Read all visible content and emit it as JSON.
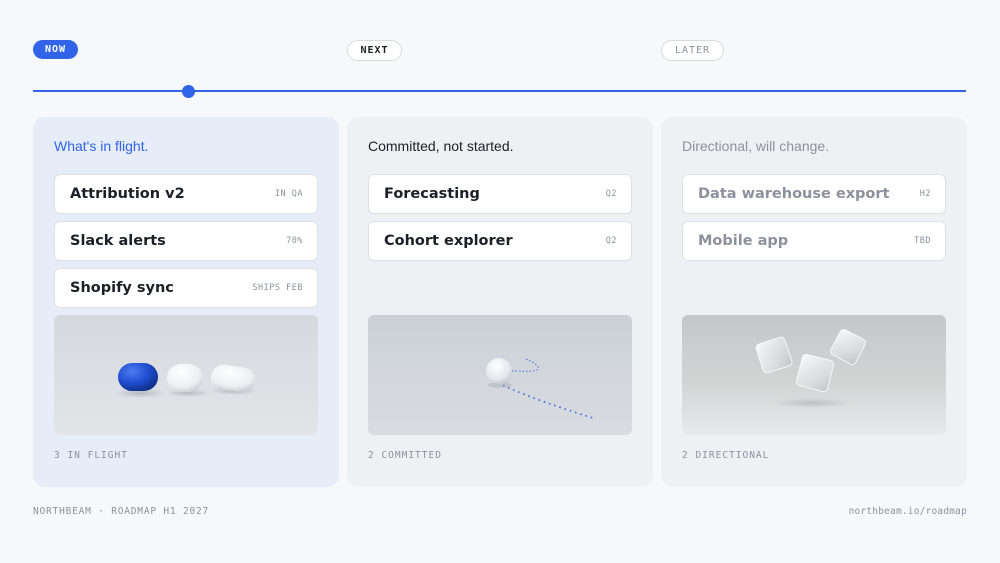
{
  "timeline": {
    "now_label": "NOW",
    "next_label": "NEXT",
    "later_label": "LATER",
    "accent": "#3164e8"
  },
  "columns": {
    "now": {
      "heading": "What's in flight.",
      "items": [
        {
          "title": "Attribution v2",
          "tag": "IN QA"
        },
        {
          "title": "Slack alerts",
          "tag": "70%"
        },
        {
          "title": "Shopify sync",
          "tag": "SHIPS FEB"
        }
      ],
      "image": "blue-and-white-capsules",
      "footer": "3 IN FLIGHT"
    },
    "next": {
      "heading": "Committed, not started.",
      "items": [
        {
          "title": "Forecasting",
          "tag": "Q2"
        },
        {
          "title": "Cohort explorer",
          "tag": "Q2"
        }
      ],
      "image": "white-ball-with-dotted-trail",
      "footer": "2 COMMITTED"
    },
    "later": {
      "heading": "Directional, will change.",
      "items": [
        {
          "title": "Data warehouse export",
          "tag": "H2"
        },
        {
          "title": "Mobile app",
          "tag": "TBD"
        }
      ],
      "image": "floating-glass-cubes",
      "footer": "2 DIRECTIONAL"
    }
  },
  "footer": {
    "left": "NORTHBEAM · ROADMAP H1 2027",
    "right": "northbeam.io/roadmap"
  }
}
